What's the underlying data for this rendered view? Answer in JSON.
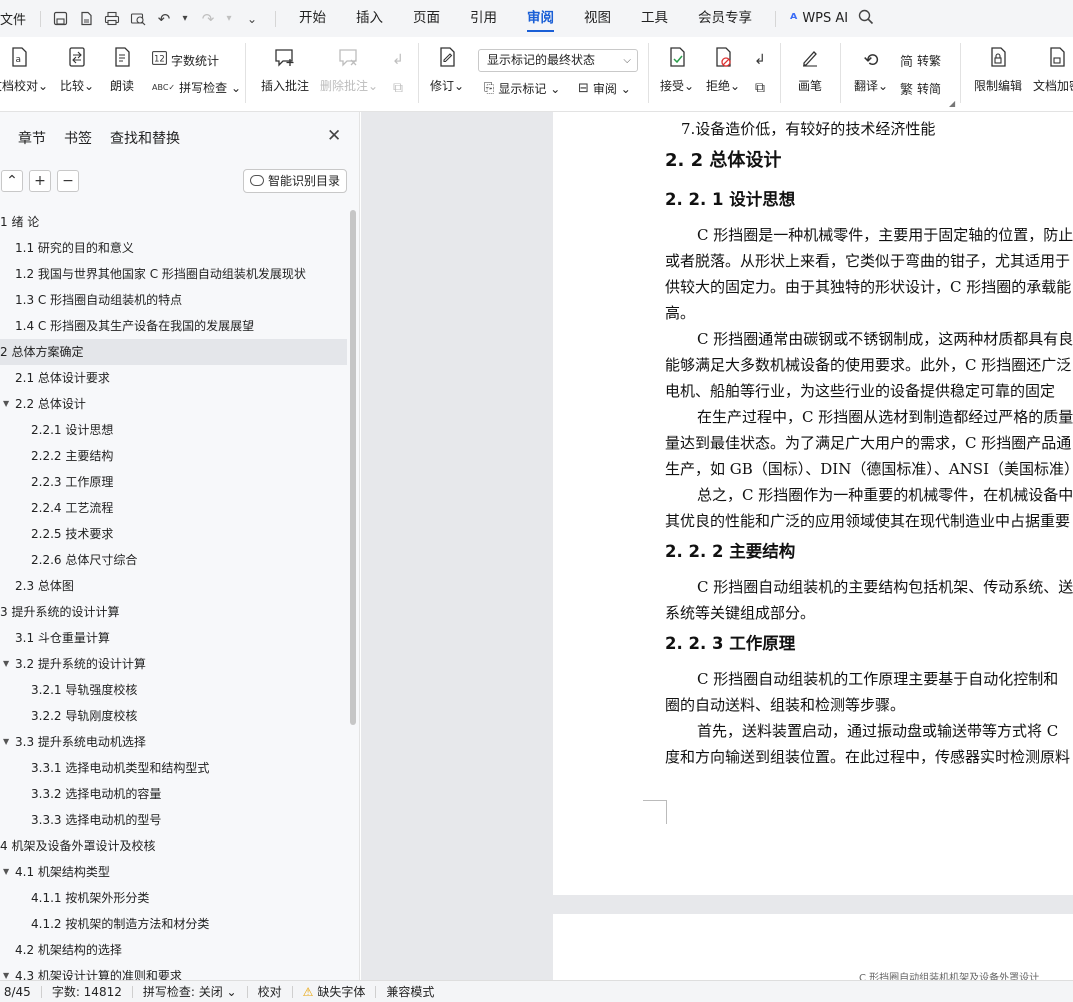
{
  "menubar": {
    "file": "文件",
    "tabs": [
      "开始",
      "插入",
      "页面",
      "引用",
      "审阅",
      "视图",
      "工具",
      "会员专享"
    ],
    "active_tab": "审阅",
    "wps_ai": "WPS AI",
    "accent": "#1a5fd6"
  },
  "ribbon": {
    "doc_check": "文档校对",
    "compare": "比较",
    "read_aloud": "朗读",
    "word_count": "字数统计",
    "spell_check": "拼写检查",
    "insert_comment": "插入批注",
    "delete_comment": "删除批注",
    "track_changes": "修订",
    "markup_state": "显示标记的最终状态",
    "show_markup": "显示标记",
    "review": "审阅",
    "accept": "接受",
    "reject": "拒绝",
    "pen": "画笔",
    "translate": "翻译",
    "to_traditional": "转繁",
    "to_simplified": "转简",
    "restrict_editing": "限制编辑",
    "doc_encrypt": "文档加密"
  },
  "nav": {
    "tabs": [
      "章节",
      "书签",
      "查找和替换"
    ],
    "smart_toc": "智能识别目录",
    "items": [
      {
        "text": "1  绪    论",
        "level": 1
      },
      {
        "text": "1.1 研究的目的和意义",
        "level": 2
      },
      {
        "text": "1.2  我国与世界其他国家 C 形挡圈自动组装机发展现状",
        "level": 2
      },
      {
        "text": "1.3 C 形挡圈自动组装机的特点",
        "level": 2
      },
      {
        "text": "1.4 C 形挡圈及其生产设备在我国的发展展望",
        "level": 2
      },
      {
        "text": "2  总体方案确定",
        "level": 1,
        "selected": true
      },
      {
        "text": "2.1  总体设计要求",
        "level": 2
      },
      {
        "text": "2.2  总体设计",
        "level": 2,
        "expanded": true
      },
      {
        "text": "2.2.1  设计思想",
        "level": 3
      },
      {
        "text": "2.2.2  主要结构",
        "level": 3
      },
      {
        "text": "2.2.3  工作原理",
        "level": 3
      },
      {
        "text": "2.2.4  工艺流程",
        "level": 3
      },
      {
        "text": "2.2.5  技术要求",
        "level": 3
      },
      {
        "text": "2.2.6  总体尺寸综合",
        "level": 3
      },
      {
        "text": "2.3  总体图",
        "level": 2
      },
      {
        "text": "3  提升系统的设计计算",
        "level": 1
      },
      {
        "text": "3.1  斗仓重量计算",
        "level": 2
      },
      {
        "text": "3.2  提升系统的设计计算",
        "level": 2,
        "expanded": true
      },
      {
        "text": "3.2.1  导轨强度校核",
        "level": 3
      },
      {
        "text": "3.2.2  导轨刚度校核",
        "level": 3
      },
      {
        "text": "3.3  提升系统电动机选择",
        "level": 2,
        "expanded": true
      },
      {
        "text": "3.3.1    选择电动机类型和结构型式",
        "level": 3
      },
      {
        "text": "3.3.2  选择电动机的容量",
        "level": 3
      },
      {
        "text": "3.3.3 选择电动机的型号",
        "level": 3
      },
      {
        "text": "4  机架及设备外罩设计及校核",
        "level": 1
      },
      {
        "text": "4.1 机架结构类型",
        "level": 2,
        "expanded": true
      },
      {
        "text": "4.1.1  按机架外形分类",
        "level": 3
      },
      {
        "text": "4.1.2  按机架的制造方法和材分类",
        "level": 3
      },
      {
        "text": "4.2  机架结构的选择",
        "level": 2
      },
      {
        "text": "4.3  机架设计计算的准则和要求",
        "level": 2,
        "expanded": true
      }
    ]
  },
  "document": {
    "lines": [
      {
        "t": "p",
        "text": "7.设备造价低，有较好的技术经济性能",
        "x": 16
      },
      {
        "t": "h2",
        "text": "2. 2  总体设计",
        "x": 0
      },
      {
        "t": "h3",
        "text": "2. 2. 1  设计思想",
        "x": 0
      },
      {
        "t": "p",
        "text": "C 形挡圈是一种机械零件，主要用于固定轴的位置，防止",
        "x": 32
      },
      {
        "t": "p",
        "text": "或者脱落。从形状上来看，它类似于弯曲的钳子，尤其适用于",
        "x": 0
      },
      {
        "t": "p",
        "text": "供较大的固定力。由于其独特的形状设计，C 形挡圈的承载能",
        "x": 0
      },
      {
        "t": "p",
        "text": "高。",
        "x": 0
      },
      {
        "t": "p",
        "text": "C 形挡圈通常由碳钢或不锈钢制成，这两种材质都具有良",
        "x": 32
      },
      {
        "t": "p",
        "text": "能够满足大多数机械设备的使用要求。此外，C 形挡圈还广泛",
        "x": 0
      },
      {
        "t": "p",
        "text": "电机、船舶等行业，为这些行业的设备提供稳定可靠的固定",
        "x": 0
      },
      {
        "t": "p",
        "text": "在生产过程中，C 形挡圈从选材到制造都经过严格的质量",
        "x": 32
      },
      {
        "t": "p",
        "text": "量达到最佳状态。为了满足广大用户的需求，C 形挡圈产品通",
        "x": 0
      },
      {
        "t": "p",
        "text": "生产，如 GB（国标）、DIN（德国标准）、ANSI（美国标准）",
        "x": 0
      },
      {
        "t": "p",
        "text": "总之，C 形挡圈作为一种重要的机械零件，在机械设备中发",
        "x": 32
      },
      {
        "t": "p",
        "text": "其优良的性能和广泛的应用领域使其在现代制造业中占据重要",
        "x": 0
      },
      {
        "t": "h3",
        "text": "2. 2. 2  主要结构",
        "x": 0
      },
      {
        "t": "p",
        "text": "C 形挡圈自动组装机的主要结构包括机架、传动系统、送",
        "x": 32
      },
      {
        "t": "p",
        "text": "系统等关键组成部分。",
        "x": 0
      },
      {
        "t": "h3",
        "text": "2. 2. 3  工作原理",
        "x": 0
      },
      {
        "t": "p",
        "text": "C 形挡圈自动组装机的工作原理主要基于自动化控制和",
        "x": 32
      },
      {
        "t": "p",
        "text": "圈的自动送料、组装和检测等步骤。",
        "x": 0
      },
      {
        "t": "p",
        "text": "首先，送料装置启动，通过振动盘或输送带等方式将 C",
        "x": 32
      },
      {
        "t": "p",
        "text": "度和方向输送到组装位置。在此过程中，传感器实时检测原料",
        "x": 0
      }
    ],
    "next_page_header": "C 形挡圈自动组装机机架及设备外罩设计"
  },
  "status": {
    "page": "页: 8/45",
    "word_count": "字数: 14812",
    "spell_check": "拼写检查: 关闭",
    "proofread": "校对",
    "missing_font": "缺失字体",
    "compat_mode": "兼容模式"
  }
}
